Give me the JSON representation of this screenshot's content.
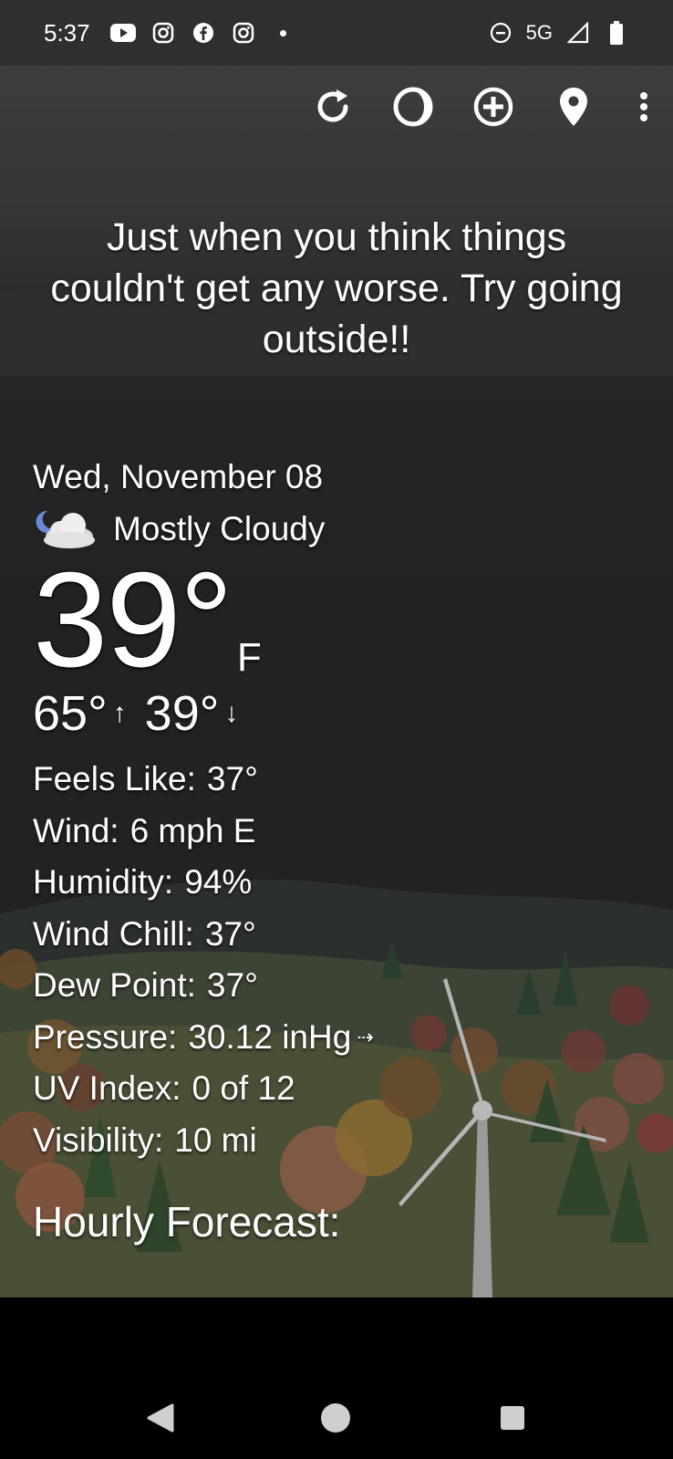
{
  "status_bar": {
    "time": "5:37",
    "network": "5G",
    "notification_icons": [
      "youtube-icon",
      "instagram-icon",
      "facebook-icon",
      "instagram-icon",
      "dot-icon"
    ],
    "system_icons": [
      "do-not-disturb-icon",
      "signal-icon",
      "battery-icon"
    ]
  },
  "toolbar": {
    "actions": [
      "refresh-icon",
      "theme-icon",
      "add-location-icon",
      "location-pin-icon",
      "more-vert-icon"
    ]
  },
  "quote": "Just when you think things couldn't get any worse. Try going outside!!",
  "weather": {
    "date": "Wed, November 08",
    "condition": "Mostly Cloudy",
    "condition_icon": "night-cloudy-icon",
    "temperature": "39°",
    "unit": "F",
    "high": "65°",
    "high_arrow": "↑",
    "low": "39°",
    "low_arrow": "↓"
  },
  "details": [
    {
      "label": "Feels Like:",
      "value": "37°"
    },
    {
      "label": "Wind:",
      "value": "6 mph E"
    },
    {
      "label": "Humidity:",
      "value": "94%"
    },
    {
      "label": "Wind Chill:",
      "value": "37°"
    },
    {
      "label": "Dew Point:",
      "value": "37°"
    },
    {
      "label": "Pressure:",
      "value": "30.12 inHg",
      "trend": "⇢"
    },
    {
      "label": "UV Index:",
      "value": "0 of 12"
    },
    {
      "label": "Visibility:",
      "value": "10 mi"
    }
  ],
  "hourly_title": "Hourly Forecast:",
  "nav": [
    "back-icon",
    "home-icon",
    "recents-icon"
  ],
  "colors": {
    "status_bar": "#2f2f2f",
    "background": "#222222",
    "text": "#ffffff"
  }
}
